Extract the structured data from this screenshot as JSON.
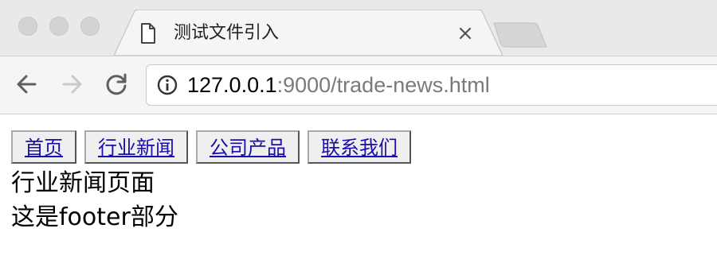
{
  "browser": {
    "tab": {
      "title": "测试文件引入"
    },
    "address_bar": {
      "host": "127.0.0.1",
      "rest": ":9000/trade-news.html"
    },
    "icons": [
      "back-icon",
      "forward-icon",
      "reload-icon",
      "info-icon",
      "document-icon",
      "close-icon"
    ]
  },
  "page": {
    "nav": [
      {
        "label": "首页"
      },
      {
        "label": "行业新闻"
      },
      {
        "label": "公司产品"
      },
      {
        "label": "联系我们"
      }
    ],
    "heading": "行业新闻页面",
    "footer": "这是footer部分"
  },
  "colors": {
    "link": "#1a0dab",
    "tabstrip_bg": "#e9e9e9",
    "toolbar_bg": "#f5f5f5"
  }
}
